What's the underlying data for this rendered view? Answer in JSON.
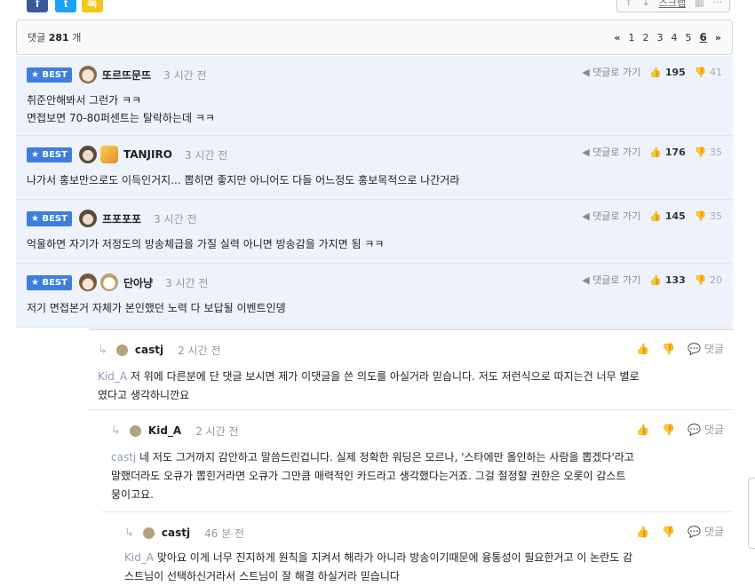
{
  "share": {
    "fb": "f",
    "tw": "t",
    "ka": "톡"
  },
  "toolbar": {
    "up": "↑",
    "down": "↓",
    "scrap": "스크랩",
    "chart": "▥",
    "more": "···"
  },
  "header": {
    "count_label": "댓글",
    "count": "281",
    "count_unit": "개",
    "pages": [
      "«",
      "1",
      "2",
      "3",
      "4",
      "5",
      "6",
      "»"
    ],
    "current_page": "6"
  },
  "best_label": "★ BEST",
  "goto_label": "◀ 댓글로 가기",
  "best_comments": [
    {
      "nick": "또르뜨문뜨",
      "time": "3 시간 전",
      "text1": "취준안해봐서 그런가 ㅋㅋ",
      "text2": "면접보면 70-80퍼센트는 탈락하는데 ㅋㅋ",
      "likes": "195",
      "dislikes": "41"
    },
    {
      "nick": "TANJIRO",
      "time": "3 시간 전",
      "text1": "나가서 홍보만으로도 이득인거지... 뽑히면 좋지만 아니어도 다들 어느정도 홍보목적으로 나간거라",
      "likes": "176",
      "dislikes": "35"
    },
    {
      "nick": "프포포포",
      "time": "3 시간 전",
      "text1": "억울하면 자기가 저정도의 방송체급을 가질 실력 아니면 방송감을 가지면 됨 ㅋㅋ",
      "likes": "145",
      "dislikes": "35"
    },
    {
      "nick": "단아냥",
      "time": "3 시간 전",
      "text1": "저기 면접본거 자체가 본인했던 노력 다 보답될 이벤트인뎅",
      "likes": "133",
      "dislikes": "20"
    }
  ],
  "reply_label": "댓글",
  "replies": [
    {
      "nick": "castj",
      "time": "2 시간 전",
      "mention": "Kid_A",
      "line1": "저 위에 다른분에 단 댓글 보시면 제가 이댓글을 쓴 의도를 아실거라 믿습니다. 저도 저런식으로 따지는건 너무 별로",
      "line2": "였다고 생각하니깐요",
      "line3": ""
    },
    {
      "nick": "Kid_A",
      "time": "2 시간 전",
      "mention": "castj",
      "line1": "네 저도 그거까지 감안하고 말씀드린겁니다. 실제 정확한 워딩은 모르나, '스타에만 올인하는 사람을 뽑겠다'라고",
      "line2": "말했더라도 오큐가 뽑힌거라면 오큐가 그만큼 매력적인 카드라고 생각했다는거죠. 그걸 절정할 권한은 오롯이 감스트",
      "line3": "뭉이고요."
    },
    {
      "nick": "castj",
      "time": "46 분 전",
      "mention": "Kid_A",
      "line1": "맞아요 이게 너무 진지하게 원칙을 지켜서 해라가 아니라 방송이기때문에 융통성이 필요한거고 이 논란도 감",
      "line2": "스트님이 선택하신거라서 스트님이 잘 해결 하실거라 믿습니다",
      "line3": ""
    }
  ]
}
